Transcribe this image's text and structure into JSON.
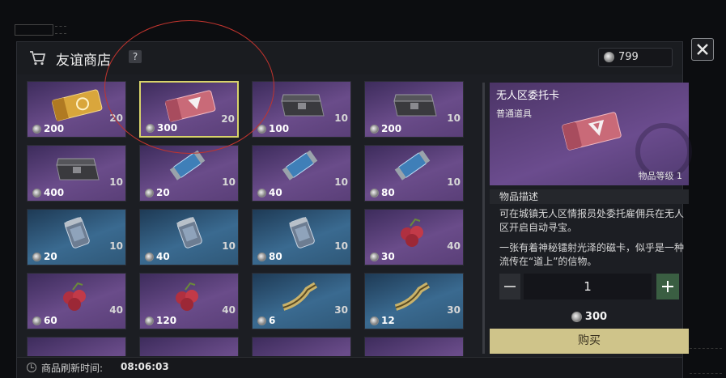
{
  "shop": {
    "title": "友谊商店",
    "help": "?",
    "currency": "799"
  },
  "items": [
    {
      "price": "200",
      "qty": "20",
      "kind": "ticket-gold",
      "bg": "purple"
    },
    {
      "price": "300",
      "qty": "20",
      "kind": "ticket-pink",
      "bg": "purple",
      "selected": true
    },
    {
      "price": "100",
      "qty": "10",
      "kind": "crate",
      "bg": "purple"
    },
    {
      "price": "200",
      "qty": "10",
      "kind": "crate",
      "bg": "purple"
    },
    {
      "price": "400",
      "qty": "10",
      "kind": "crate",
      "bg": "purple"
    },
    {
      "price": "20",
      "qty": "10",
      "kind": "canister",
      "bg": "purple"
    },
    {
      "price": "40",
      "qty": "10",
      "kind": "canister",
      "bg": "purple"
    },
    {
      "price": "80",
      "qty": "10",
      "kind": "canister",
      "bg": "purple"
    },
    {
      "price": "20",
      "qty": "10",
      "kind": "jar",
      "bg": "blue"
    },
    {
      "price": "40",
      "qty": "10",
      "kind": "jar",
      "bg": "blue"
    },
    {
      "price": "80",
      "qty": "10",
      "kind": "jar",
      "bg": "blue"
    },
    {
      "price": "30",
      "qty": "40",
      "kind": "berries",
      "bg": "purple"
    },
    {
      "price": "60",
      "qty": "40",
      "kind": "berries",
      "bg": "purple"
    },
    {
      "price": "120",
      "qty": "40",
      "kind": "berries",
      "bg": "purple"
    },
    {
      "price": "6",
      "qty": "30",
      "kind": "pipe",
      "bg": "blue"
    },
    {
      "price": "12",
      "qty": "30",
      "kind": "pipe",
      "bg": "blue"
    }
  ],
  "detail": {
    "name": "无人区委托卡",
    "type": "普通道具",
    "level": "物品等级 1",
    "desc_header": "物品描述",
    "desc1": "可在城镇无人区情报员处委托雇佣兵在无人区开启自动寻宝。",
    "desc2": "一张有着神秘镭射光泽的磁卡，似乎是一种流传在“道上”的信物。",
    "quantity": "1",
    "total": "300",
    "buy": "购买"
  },
  "footer": {
    "refresh_label": "商品刷新时间:",
    "refresh_time": "08:06:03"
  },
  "colors": {
    "selected_border": "#d8d36a",
    "buy_button": "#cfc48a",
    "plus_button": "#3a5e42",
    "annotation_circle": "#c0342e"
  }
}
